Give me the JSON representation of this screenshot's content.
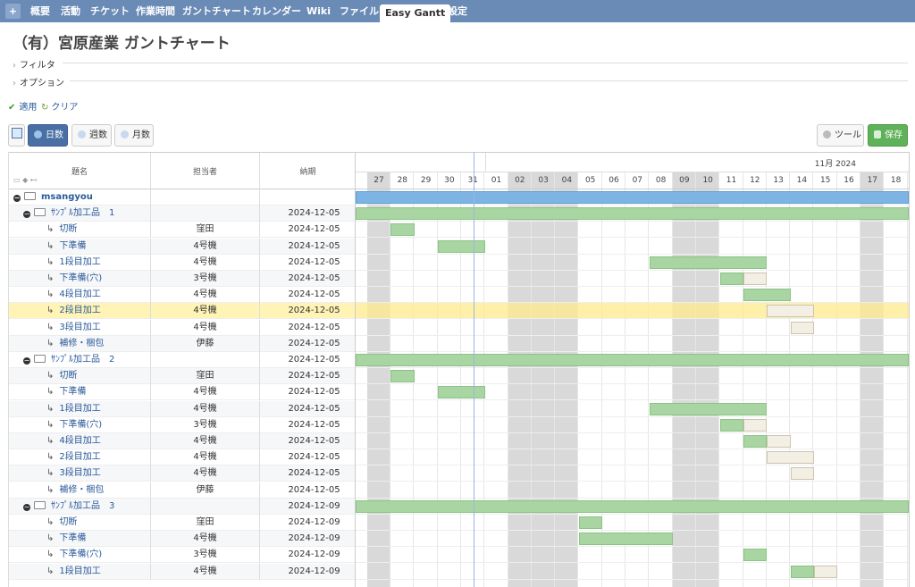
{
  "nav": {
    "plus": "+",
    "tabs": [
      "概要",
      "活動",
      "チケット",
      "作業時間",
      "ガントチャート",
      "カレンダー",
      "Wiki",
      "ファイル",
      "Easy Gantt",
      "設定"
    ],
    "active": "Easy Gantt"
  },
  "title": "（有）宮原産業 ガントチャート",
  "filters": {
    "filter_label": "フィルタ",
    "option_label": "オプション",
    "apply": "適用",
    "clear": "クリア"
  },
  "toolbar": {
    "days": "日数",
    "weeks": "週数",
    "months": "月数",
    "tools": "ツール",
    "save": "保存"
  },
  "columns": {
    "name": "題名",
    "assignee": "担当者",
    "due": "納期"
  },
  "timeline": {
    "month_label": "11月 2024",
    "days": [
      "27",
      "28",
      "29",
      "30",
      "31",
      "01",
      "02",
      "03",
      "04",
      "05",
      "06",
      "07",
      "08",
      "09",
      "10",
      "11",
      "12",
      "13",
      "14",
      "15",
      "16",
      "17",
      "18"
    ],
    "weekend_indices": [
      0,
      6,
      7,
      8,
      13,
      14,
      21
    ]
  },
  "rows": [
    {
      "name": "msangyou",
      "assignee": "",
      "due": "",
      "level": 0,
      "bars": [
        {
          "s": 0,
          "e": 23,
          "k": "proj"
        }
      ]
    },
    {
      "name": "ｻﾝﾌﾟﾙ加工品　1",
      "assignee": "",
      "due": "2024-12-05",
      "level": 1,
      "bars": [
        {
          "s": 0,
          "e": 23,
          "k": "sum"
        }
      ]
    },
    {
      "name": "切断",
      "assignee": "窪田",
      "due": "2024-12-05",
      "level": 2,
      "bars": [
        {
          "s": 1.5,
          "e": 2.5,
          "k": "done"
        }
      ]
    },
    {
      "name": "下準備",
      "assignee": "4号機",
      "due": "2024-12-05",
      "level": 2,
      "bars": [
        {
          "s": 3.5,
          "e": 5.5,
          "k": "done"
        }
      ]
    },
    {
      "name": "1段目加工",
      "assignee": "4号機",
      "due": "2024-12-05",
      "level": 2,
      "bars": [
        {
          "s": 12.5,
          "e": 17.5,
          "k": "done"
        }
      ]
    },
    {
      "name": "下準備(穴)",
      "assignee": "3号機",
      "due": "2024-12-05",
      "level": 2,
      "bars": [
        {
          "s": 15.5,
          "e": 16.5,
          "k": "done"
        },
        {
          "s": 16.5,
          "e": 17.5,
          "k": "todo"
        }
      ]
    },
    {
      "name": "4段目加工",
      "assignee": "4号機",
      "due": "2024-12-05",
      "level": 2,
      "bars": [
        {
          "s": 16.5,
          "e": 18.5,
          "k": "done"
        }
      ]
    },
    {
      "name": "2段目加工",
      "assignee": "4号機",
      "due": "2024-12-05",
      "level": 2,
      "hl": true,
      "bars": [
        {
          "s": 17.5,
          "e": 19.5,
          "k": "todo"
        }
      ]
    },
    {
      "name": "3段目加工",
      "assignee": "4号機",
      "due": "2024-12-05",
      "level": 2,
      "bars": [
        {
          "s": 18.5,
          "e": 19.5,
          "k": "todo"
        }
      ]
    },
    {
      "name": "補修・梱包",
      "assignee": "伊藤",
      "due": "2024-12-05",
      "level": 2,
      "bars": []
    },
    {
      "name": "ｻﾝﾌﾟﾙ加工品　2",
      "assignee": "",
      "due": "2024-12-05",
      "level": 1,
      "bars": [
        {
          "s": 0,
          "e": 23,
          "k": "sum"
        }
      ]
    },
    {
      "name": "切断",
      "assignee": "窪田",
      "due": "2024-12-05",
      "level": 2,
      "bars": [
        {
          "s": 1.5,
          "e": 2.5,
          "k": "done"
        }
      ]
    },
    {
      "name": "下準備",
      "assignee": "4号機",
      "due": "2024-12-05",
      "level": 2,
      "bars": [
        {
          "s": 3.5,
          "e": 5.5,
          "k": "done"
        }
      ]
    },
    {
      "name": "1段目加工",
      "assignee": "4号機",
      "due": "2024-12-05",
      "level": 2,
      "bars": [
        {
          "s": 12.5,
          "e": 17.5,
          "k": "done"
        }
      ]
    },
    {
      "name": "下準備(穴)",
      "assignee": "3号機",
      "due": "2024-12-05",
      "level": 2,
      "bars": [
        {
          "s": 15.5,
          "e": 16.5,
          "k": "done"
        },
        {
          "s": 16.5,
          "e": 17.5,
          "k": "todo"
        }
      ]
    },
    {
      "name": "4段目加工",
      "assignee": "4号機",
      "due": "2024-12-05",
      "level": 2,
      "bars": [
        {
          "s": 16.5,
          "e": 17.5,
          "k": "done"
        },
        {
          "s": 17.5,
          "e": 18.5,
          "k": "todo"
        }
      ]
    },
    {
      "name": "2段目加工",
      "assignee": "4号機",
      "due": "2024-12-05",
      "level": 2,
      "bars": [
        {
          "s": 17.5,
          "e": 19.5,
          "k": "todo"
        }
      ]
    },
    {
      "name": "3段目加工",
      "assignee": "4号機",
      "due": "2024-12-05",
      "level": 2,
      "bars": [
        {
          "s": 18.5,
          "e": 19.5,
          "k": "todo"
        }
      ]
    },
    {
      "name": "補修・梱包",
      "assignee": "伊藤",
      "due": "2024-12-05",
      "level": 2,
      "bars": []
    },
    {
      "name": "ｻﾝﾌﾟﾙ加工品　3",
      "assignee": "",
      "due": "2024-12-09",
      "level": 1,
      "bars": [
        {
          "s": 0,
          "e": 23,
          "k": "sum"
        }
      ]
    },
    {
      "name": "切断",
      "assignee": "窪田",
      "due": "2024-12-09",
      "level": 2,
      "bars": [
        {
          "s": 9.5,
          "e": 10.5,
          "k": "done"
        }
      ]
    },
    {
      "name": "下準備",
      "assignee": "4号機",
      "due": "2024-12-09",
      "level": 2,
      "bars": [
        {
          "s": 9.5,
          "e": 13.5,
          "k": "done"
        }
      ]
    },
    {
      "name": "下準備(穴)",
      "assignee": "3号機",
      "due": "2024-12-09",
      "level": 2,
      "bars": [
        {
          "s": 16.5,
          "e": 17.5,
          "k": "done"
        }
      ]
    },
    {
      "name": "1段目加工",
      "assignee": "4号機",
      "due": "2024-12-09",
      "level": 2,
      "bars": [
        {
          "s": 18.5,
          "e": 19.5,
          "k": "done"
        },
        {
          "s": 19.5,
          "e": 20.5,
          "k": "todo"
        }
      ]
    }
  ]
}
